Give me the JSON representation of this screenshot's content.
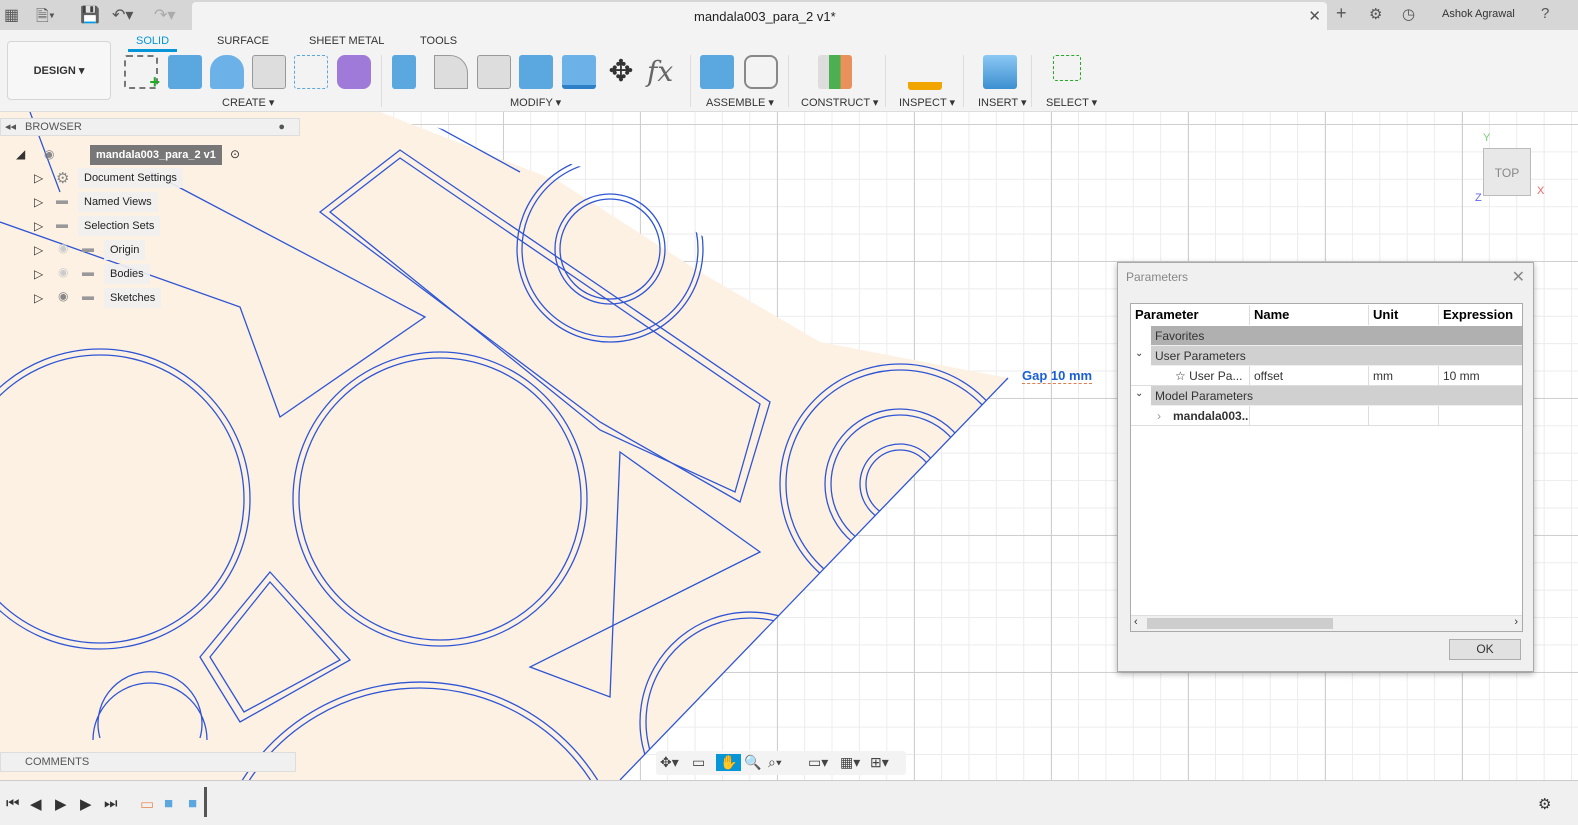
{
  "title_bar": {
    "document_title": "mandala003_para_2 v1*",
    "user": "Ashok Agrawal"
  },
  "ribbon": {
    "workspace": "DESIGN ▾",
    "tabs": [
      "SOLID",
      "SURFACE",
      "SHEET METAL",
      "TOOLS"
    ],
    "active_tab": "SOLID",
    "groups": [
      "CREATE ▾",
      "MODIFY ▾",
      "ASSEMBLE ▾",
      "CONSTRUCT ▾",
      "INSPECT ▾",
      "INSERT ▾",
      "SELECT ▾"
    ]
  },
  "browser": {
    "title": "BROWSER",
    "root": "mandala003_para_2 v1",
    "items": [
      "Document Settings",
      "Named Views",
      "Selection Sets",
      "Origin",
      "Bodies",
      "Sketches"
    ]
  },
  "comments": {
    "title": "COMMENTS"
  },
  "viewcube": {
    "face": "TOP",
    "x": "X",
    "y": "Y",
    "z": "Z"
  },
  "dimension": {
    "label": "Gap 10 mm"
  },
  "parameters_dialog": {
    "title": "Parameters",
    "columns": [
      "Parameter",
      "Name",
      "Unit",
      "Expression"
    ],
    "groups": {
      "favorites": "Favorites",
      "user": "User Parameters",
      "model": "Model Parameters"
    },
    "user_row": {
      "parameter": "User Pa...",
      "name": "offset",
      "unit": "mm",
      "expression": "10 mm"
    },
    "model_row": {
      "parameter": "mandala003..."
    },
    "ok_label": "OK"
  },
  "colors": {
    "accent": "#0696d7",
    "sketch": "#2f55d4",
    "fill": "#fdf1e3"
  }
}
